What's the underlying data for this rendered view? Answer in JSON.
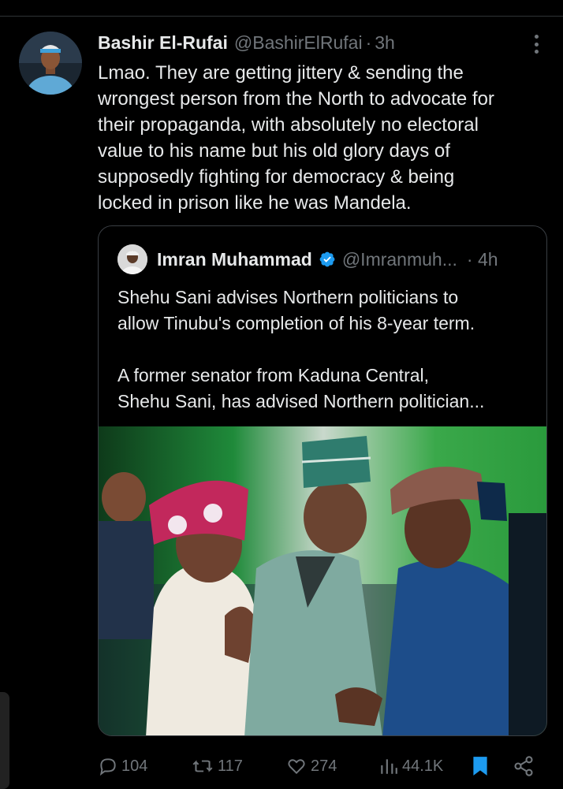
{
  "tweet": {
    "author_name": "Bashir El-Rufai",
    "author_handle": "@BashirElRufai",
    "separator": "·",
    "time": "3h",
    "text": "Lmao. They are getting jittery & sending the\nwrongest person from the North to advocate for\ntheir propaganda, with absolutely no electoral\nvalue to his name but his old glory days of\nsupposedly fighting for democracy & being\nlocked in prison like he was Mandela."
  },
  "quote": {
    "author_name": "Imran Muhammad",
    "author_handle": "@Imranmuh...",
    "time": "· 4h",
    "text": "Shehu Sani advises Northern politicians to\nallow Tinubu's completion of his 8-year term.\n\nA former senator from Kaduna Central,\nShehu Sani, has advised Northern politician..."
  },
  "actions": {
    "replies": "104",
    "reposts": "117",
    "likes": "274",
    "views": "44.1K"
  },
  "colors": {
    "background": "#000000",
    "text": "#e7e9ea",
    "muted": "#71767b",
    "verified": "#1d9bf0",
    "bookmark": "#1d9bf0"
  },
  "icons": [
    "more-icon",
    "verified-icon",
    "reply-icon",
    "repost-icon",
    "like-icon",
    "views-icon",
    "bookmark-icon",
    "share-icon"
  ]
}
